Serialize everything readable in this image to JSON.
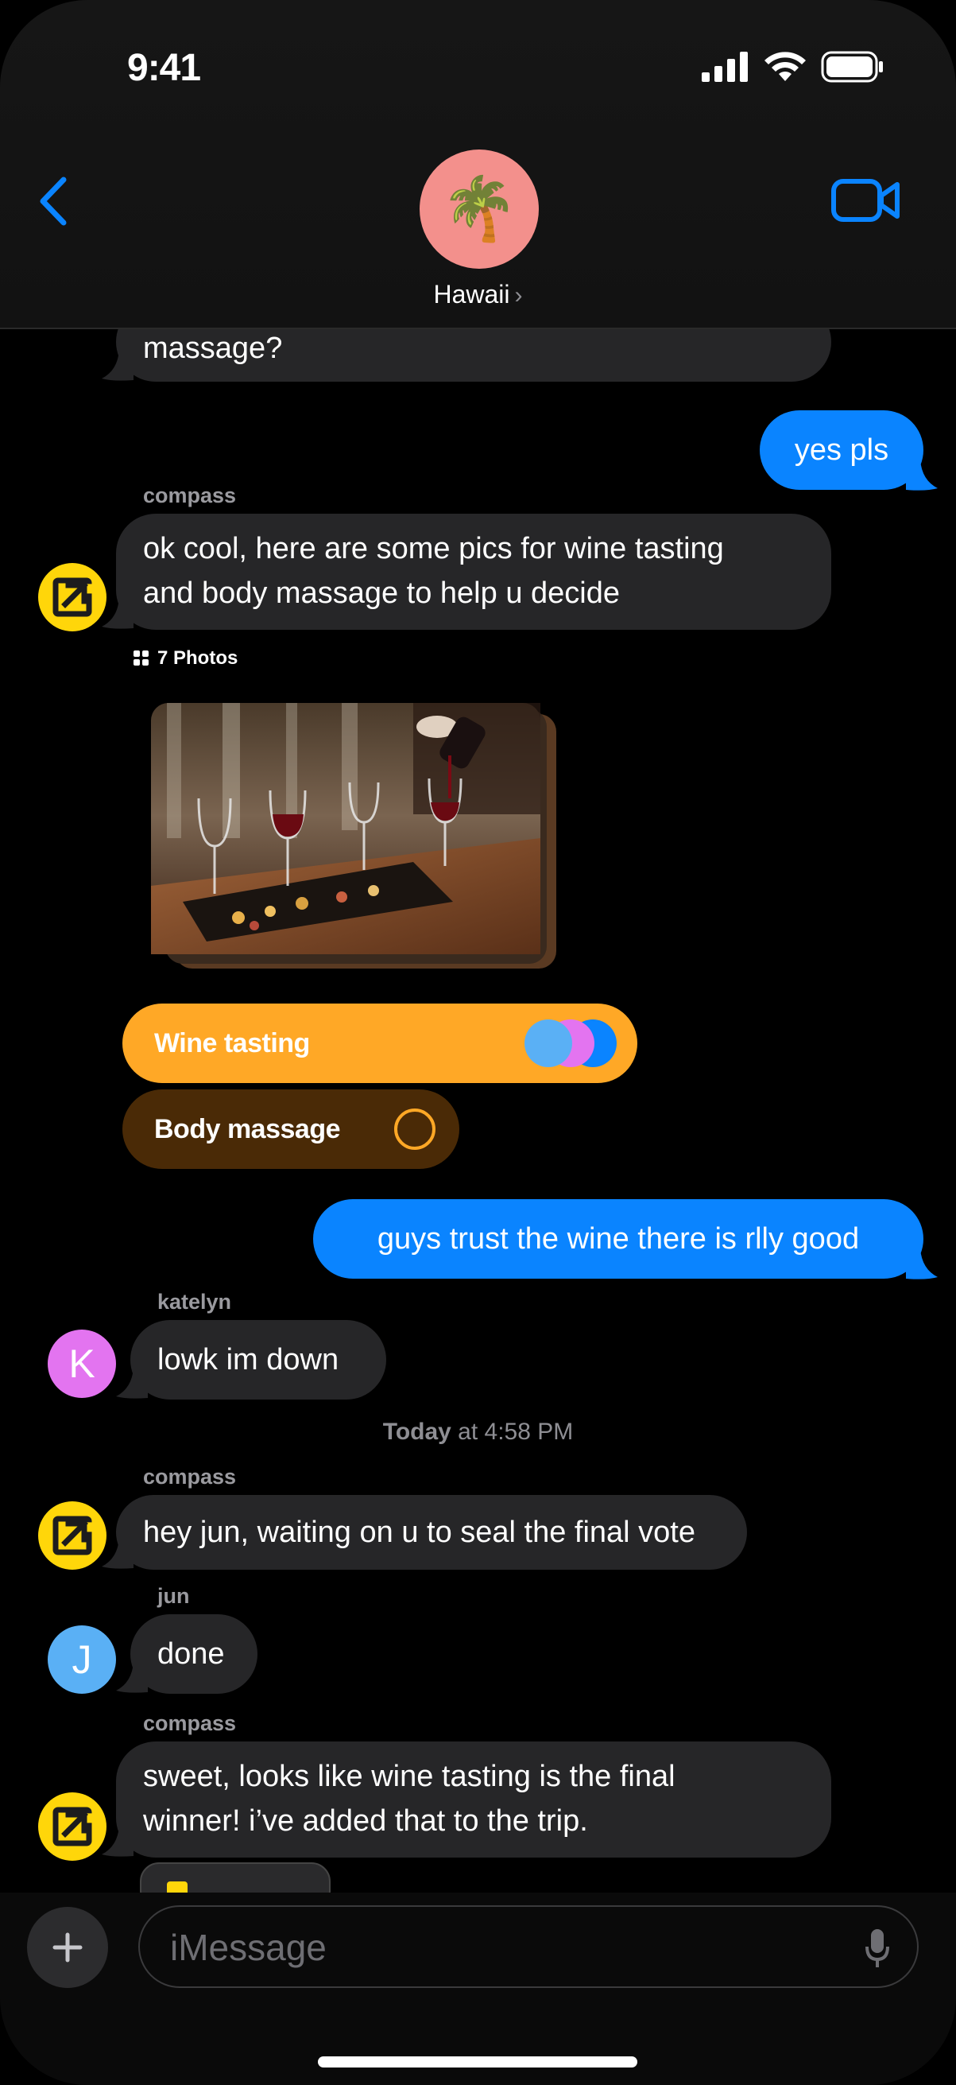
{
  "status_bar": {
    "time": "9:41"
  },
  "header": {
    "group_name": "Hawaii",
    "avatar_emoji": "🌴"
  },
  "messages": {
    "m0": {
      "text": "massage?"
    },
    "m1": {
      "text": "yes pls"
    },
    "m2": {
      "sender": "compass",
      "line1": "ok cool, here are some pics for wine tasting",
      "line2": "and body massage to help u decide"
    },
    "photos_label": "7 Photos",
    "poll": {
      "option1": {
        "label": "Wine tasting",
        "selected": true
      },
      "option2": {
        "label": "Body massage",
        "selected": false
      }
    },
    "m3": {
      "text": "guys trust the wine there is rlly good"
    },
    "m4": {
      "sender": "katelyn",
      "avatar_letter": "K",
      "text": "lowk im down"
    },
    "timestamp": {
      "day": "Today",
      "rest": " at 4:58 PM"
    },
    "m5": {
      "sender": "compass",
      "text": "hey jun, waiting on u to seal the final vote"
    },
    "m6": {
      "sender": "jun",
      "avatar_letter": "J",
      "text": "done"
    },
    "m7": {
      "sender": "compass",
      "line1": "sweet, looks like wine tasting is the final",
      "line2": "winner! i’ve added that to the trip."
    }
  },
  "input": {
    "placeholder": "iMessage"
  },
  "colors": {
    "accent": "#0a84ff",
    "compass_yellow": "#ffd60a",
    "poll_orange": "#ffa826",
    "poll_brown": "#4a2a06"
  }
}
